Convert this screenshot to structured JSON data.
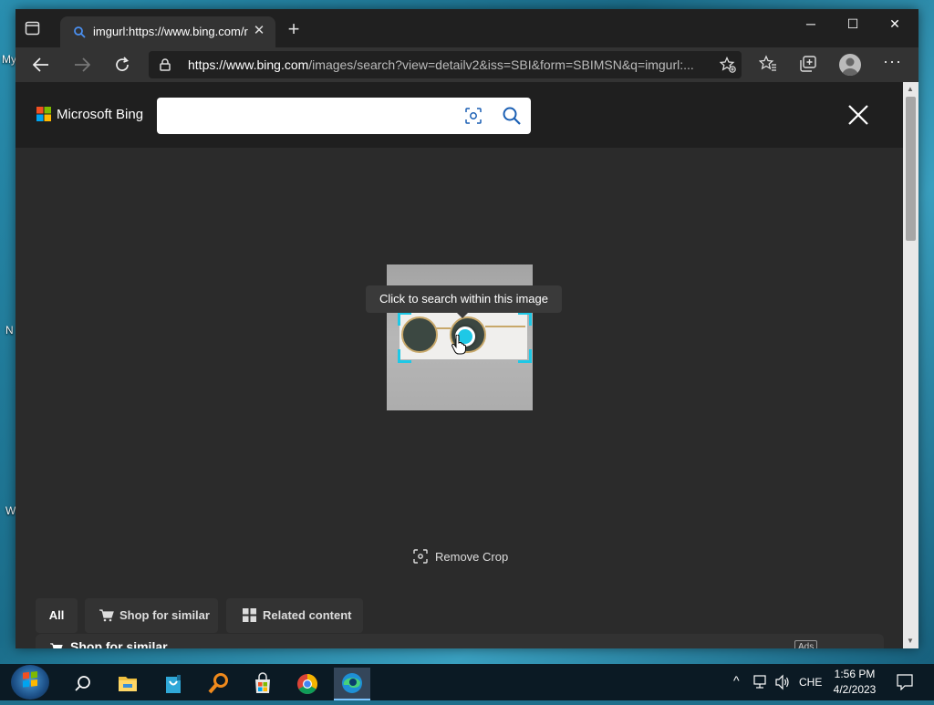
{
  "desktop": {
    "labels": [
      "My",
      "N",
      "W"
    ]
  },
  "browser": {
    "tab": {
      "title": "imgurl:https://www.bing.com/rp/..."
    },
    "address": {
      "host": "https://www.bing.com",
      "path": "/images/search?view=detailv2&iss=SBI&form=SBIMSN&q=imgurl:..."
    },
    "window_controls": {
      "minimize": "─",
      "maximize": "☐",
      "close": "✕"
    },
    "more_label": "···"
  },
  "bing": {
    "logo_text": "Microsoft Bing",
    "search": {
      "value": "",
      "placeholder": ""
    }
  },
  "viewer": {
    "tooltip": "Click to search within this image",
    "remove_crop": "Remove Crop"
  },
  "result_tabs": [
    {
      "label": "All",
      "active": true
    },
    {
      "label": "Shop for similar",
      "active": false
    },
    {
      "label": "Related content",
      "active": false
    }
  ],
  "shop_panel": {
    "title": "Shop for similar",
    "ads": "Ads"
  },
  "taskbar": {
    "apps": [
      "search",
      "file-explorer",
      "store-bag",
      "search-app",
      "microsoft-store",
      "chrome",
      "edge"
    ],
    "tray": {
      "language": "CHE",
      "time": "1:56 PM",
      "date": "4/2/2023"
    }
  },
  "colors": {
    "accent": "#1ec8e6",
    "page_bg": "#2b2b2b",
    "header_bg": "#1f1f1f"
  }
}
